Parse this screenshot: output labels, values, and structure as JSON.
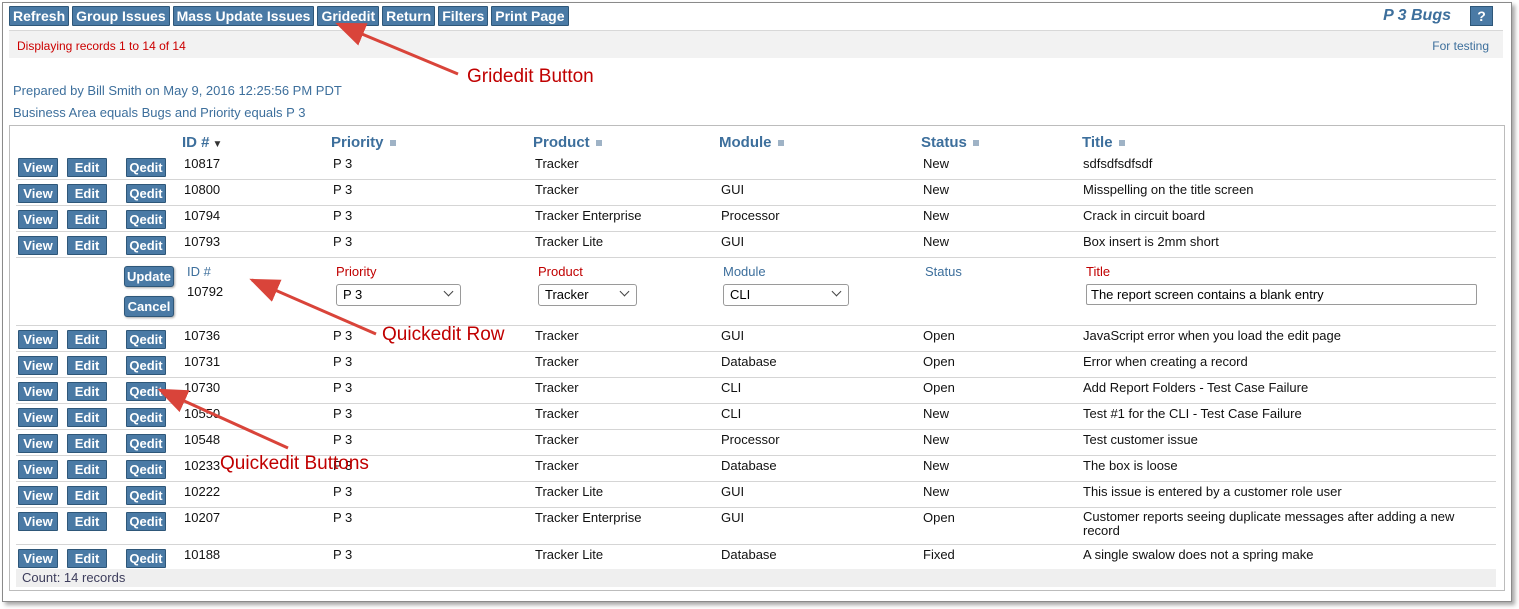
{
  "toolbar": {
    "buttons": [
      "Refresh",
      "Group Issues",
      "Mass Update Issues",
      "Gridedit",
      "Return",
      "Filters",
      "Print Page"
    ],
    "title": "P 3 Bugs",
    "help": "?"
  },
  "info": {
    "displaying": "Displaying records 1 to 14 of 14",
    "testing": "For testing"
  },
  "report": {
    "prepared": "Prepared by Bill Smith on May 9, 2016 12:25:56 PM PDT",
    "criteria": "Business Area equals Bugs and Priority equals P 3"
  },
  "columns": [
    "ID #",
    "Priority",
    "Product",
    "Module",
    "Status",
    "Title"
  ],
  "row_buttons": {
    "view": "View",
    "edit": "Edit",
    "qedit": "Qedit"
  },
  "rows_top": [
    {
      "id": "10817",
      "priority": "P 3",
      "product": "Tracker",
      "module": "",
      "status": "New",
      "title": "sdfsdfsdfsdf"
    },
    {
      "id": "10800",
      "priority": "P 3",
      "product": "Tracker",
      "module": "GUI",
      "status": "New",
      "title": "Misspelling on the title screen"
    },
    {
      "id": "10794",
      "priority": "P 3",
      "product": "Tracker Enterprise",
      "module": "Processor",
      "status": "New",
      "title": "Crack in circuit board"
    },
    {
      "id": "10793",
      "priority": "P 3",
      "product": "Tracker Lite",
      "module": "GUI",
      "status": "New",
      "title": "Box insert is 2mm short"
    }
  ],
  "quickedit": {
    "update": "Update",
    "cancel": "Cancel",
    "id_label": "ID #",
    "id_value": "10792",
    "priority_label": "Priority",
    "priority_value": "P 3",
    "product_label": "Product",
    "product_value": "Tracker",
    "module_label": "Module",
    "module_value": "CLI",
    "status_label": "Status",
    "title_label": "Title",
    "title_value": "The report screen contains a blank entry"
  },
  "rows_bottom": [
    {
      "id": "10736",
      "priority": "P 3",
      "product": "Tracker",
      "module": "GUI",
      "status": "Open",
      "title": "JavaScript error when you load the edit page"
    },
    {
      "id": "10731",
      "priority": "P 3",
      "product": "Tracker",
      "module": "Database",
      "status": "Open",
      "title": "Error when creating a record"
    },
    {
      "id": "10730",
      "priority": "P 3",
      "product": "Tracker",
      "module": "CLI",
      "status": "Open",
      "title": "Add Report Folders - Test Case Failure"
    },
    {
      "id": "10550",
      "priority": "P 3",
      "product": "Tracker",
      "module": "CLI",
      "status": "New",
      "title": "Test #1 for the CLI - Test Case Failure"
    },
    {
      "id": "10548",
      "priority": "P 3",
      "product": "Tracker",
      "module": "Processor",
      "status": "New",
      "title": "Test customer issue"
    },
    {
      "id": "10233",
      "priority": "P 3",
      "product": "Tracker",
      "module": "Database",
      "status": "New",
      "title": "The box is loose"
    },
    {
      "id": "10222",
      "priority": "P 3",
      "product": "Tracker Lite",
      "module": "GUI",
      "status": "New",
      "title": "This issue is entered by a customer role user"
    },
    {
      "id": "10207",
      "priority": "P 3",
      "product": "Tracker Enterprise",
      "module": "GUI",
      "status": "Open",
      "title": "Customer reports seeing duplicate messages after adding a new record"
    },
    {
      "id": "10188",
      "priority": "P 3",
      "product": "Tracker Lite",
      "module": "Database",
      "status": "Fixed",
      "title": "A single swalow does not a spring make"
    }
  ],
  "count": "Count: 14 records",
  "annotations": {
    "gridedit": "Gridedit Button",
    "quickedit_row": "Quickedit Row",
    "quickedit_buttons": "Quickedit Buttons"
  },
  "colors": {
    "button": "#4a7aa5",
    "accent_red": "#c00000",
    "link_blue": "#3d6f9c"
  }
}
